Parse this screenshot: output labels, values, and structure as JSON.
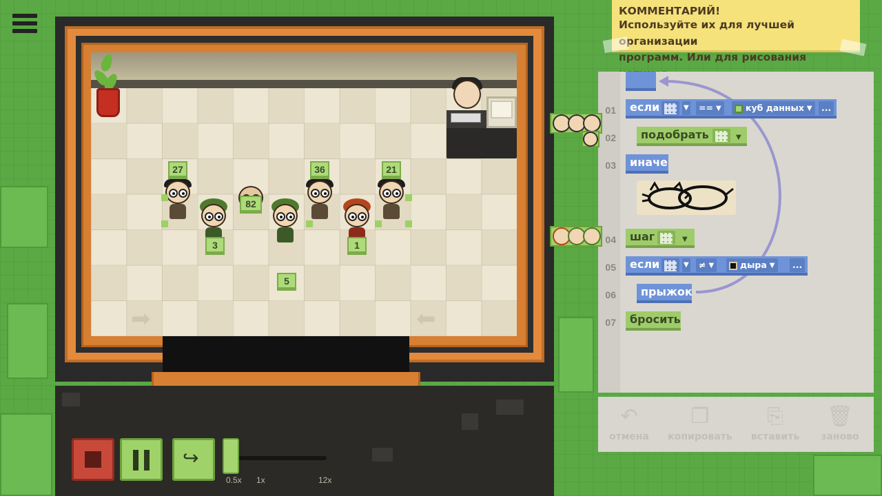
{
  "comment": {
    "line1": "КОММЕНТАРИЙ!",
    "line2": "Используйте их для лучшей организации",
    "line3": "программ. Или для рисования котиков."
  },
  "line_numbers": [
    "01",
    "02",
    "03",
    "04",
    "05",
    "06",
    "07"
  ],
  "code": {
    "if1_keyword": "если",
    "if1_operator": "==",
    "if1_target": "куб данных",
    "if1_more": "...",
    "pickup": "подобрать",
    "else": "иначе",
    "step": "шаг",
    "if2_keyword": "если",
    "if2_operator": "≠",
    "if2_target": "дыра",
    "if2_more": "...",
    "jump": "прыжок",
    "drop": "бросить"
  },
  "actions": {
    "undo": "отмена",
    "copy": "копировать",
    "paste": "вставить",
    "reset": "заново"
  },
  "speed": {
    "min": "0.5x",
    "mid": "1x",
    "max": "12x",
    "current": "0.5x"
  },
  "cubes": [
    "27",
    "36",
    "21",
    "82",
    "3",
    "1",
    "5"
  ],
  "icons": {
    "menu": "hamburger-icon",
    "stop": "stop-icon",
    "pause": "pause-icon",
    "step": "step-icon",
    "undo": "undo-icon",
    "copy": "copy-icon",
    "paste": "paste-icon",
    "reset": "trash-icon"
  },
  "colors": {
    "background": "#5aa944",
    "orange_frame": "#e48a3c",
    "block_blue": "#6f93d8",
    "block_green": "#9fcc6a",
    "comment": "#f6e27a",
    "stop": "#c8493a"
  }
}
